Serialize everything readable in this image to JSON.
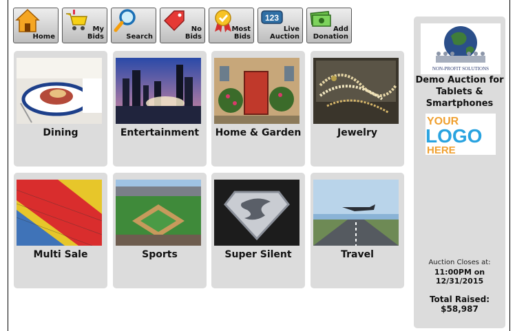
{
  "toolbar": {
    "buttons": [
      {
        "label": "Home",
        "icon": "house-icon"
      },
      {
        "label": "My Bids",
        "icon": "shopping-cart-icon"
      },
      {
        "label": "Search",
        "icon": "magnifier-icon"
      },
      {
        "label": "No Bids",
        "icon": "price-tag-icon"
      },
      {
        "label": "Most Bids",
        "icon": "award-ribbon-icon"
      },
      {
        "label": "Live Auction",
        "icon": "counter-123-icon",
        "icon_text": "123"
      },
      {
        "label": "Add Donation",
        "icon": "money-icon"
      }
    ]
  },
  "categories": [
    {
      "label": "Dining"
    },
    {
      "label": "Entertainment"
    },
    {
      "label": "Home & Garden"
    },
    {
      "label": "Jewelry"
    },
    {
      "label": "Multi Sale"
    },
    {
      "label": "Sports"
    },
    {
      "label": "Super Silent"
    },
    {
      "label": "Travel"
    }
  ],
  "sidebar": {
    "logo_text": "NON-PROFIT SOLUTIONS",
    "title": "Demo Auction for Tablets & Smartphones",
    "your_logo": {
      "line1": "YOUR",
      "line2": "LOGO",
      "line3": "HERE"
    },
    "closes_label": "Auction Closes at:",
    "closes_time": "11:00PM on 12/31/2015",
    "raised_label": "Total Raised:",
    "raised_value": "$58,987"
  },
  "colors": {
    "tile_bg": "#dcdcdc",
    "toolbar_button_top": "#eeeeee",
    "toolbar_button_bottom": "#bdbdbd",
    "logo_orange": "#f0a030",
    "logo_blue": "#29a3e0"
  }
}
